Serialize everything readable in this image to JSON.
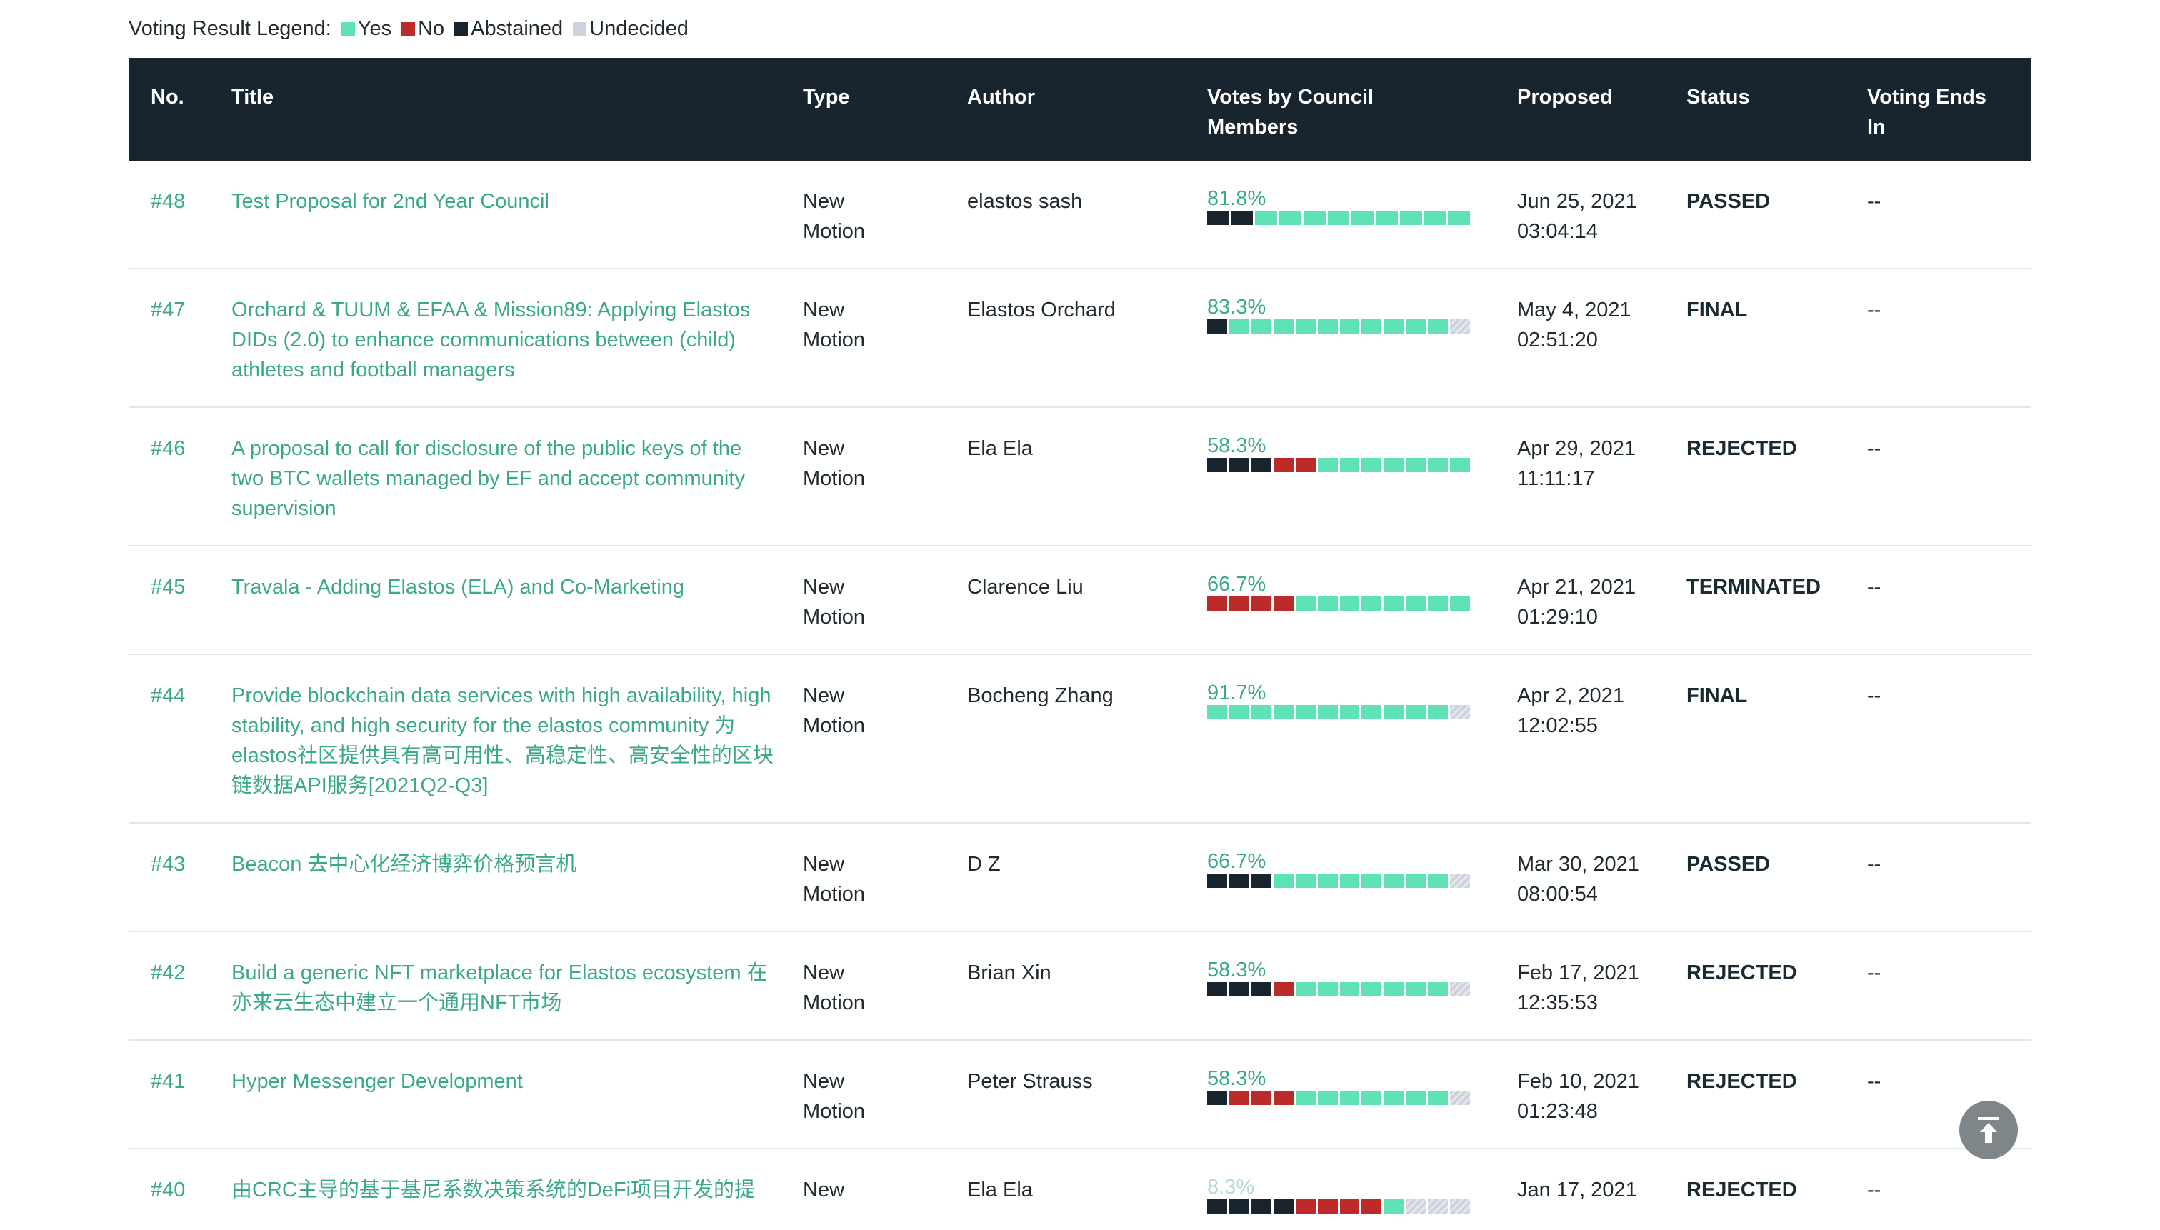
{
  "legend": {
    "label": "Voting Result Legend:",
    "items": [
      {
        "label": "Yes",
        "color": "#5fe3b4"
      },
      {
        "label": "No",
        "color": "#bd2a2a"
      },
      {
        "label": "Abstained",
        "color": "#18252f"
      },
      {
        "label": "Undecided",
        "color": "#cdd3dc"
      }
    ]
  },
  "colors": {
    "yes": "#5fe3b4",
    "no": "#bd2a2a",
    "abstained": "#18252f",
    "undecided": "#cdd3dc",
    "header_bg": "#18252f",
    "link": "#3aa98b"
  },
  "table": {
    "headers": {
      "no": "No.",
      "title": "Title",
      "type": "Type",
      "author": "Author",
      "votes": "Votes by Council Members",
      "proposed": "Proposed",
      "status": "Status",
      "ends": "Voting Ends In"
    },
    "rows": [
      {
        "no": "#48",
        "title": "Test Proposal for 2nd Year Council",
        "type": "New Motion",
        "author": "elastos sash",
        "pct": "81.8%",
        "votes": [
          "A",
          "A",
          "Y",
          "Y",
          "Y",
          "Y",
          "Y",
          "Y",
          "Y",
          "Y",
          "Y"
        ],
        "proposed": "Jun 25, 2021 03:04:14",
        "status": "PASSED",
        "ends": "--"
      },
      {
        "no": "#47",
        "title": "Orchard & TUUM & EFAA & Mission89: Applying Elastos DIDs (2.0) to enhance communications between (child) athletes and football managers",
        "type": "New Motion",
        "author": "Elastos Orchard",
        "pct": "83.3%",
        "votes": [
          "A",
          "Y",
          "Y",
          "Y",
          "Y",
          "Y",
          "Y",
          "Y",
          "Y",
          "Y",
          "Y",
          "U"
        ],
        "proposed": "May 4, 2021 02:51:20",
        "status": "FINAL",
        "ends": "--"
      },
      {
        "no": "#46",
        "title": "A proposal to call for disclosure of the public keys of the two BTC wallets managed by EF and accept community supervision",
        "type": "New Motion",
        "author": "Ela Ela",
        "pct": "58.3%",
        "votes": [
          "A",
          "A",
          "A",
          "N",
          "N",
          "Y",
          "Y",
          "Y",
          "Y",
          "Y",
          "Y",
          "Y"
        ],
        "proposed": "Apr 29, 2021 11:11:17",
        "status": "REJECTED",
        "ends": "--"
      },
      {
        "no": "#45",
        "title": "Travala - Adding Elastos (ELA) and Co-Marketing",
        "type": "New Motion",
        "author": "Clarence Liu",
        "pct": "66.7%",
        "votes": [
          "N",
          "N",
          "N",
          "N",
          "Y",
          "Y",
          "Y",
          "Y",
          "Y",
          "Y",
          "Y",
          "Y"
        ],
        "proposed": "Apr 21, 2021 01:29:10",
        "status": "TERMINATED",
        "ends": "--"
      },
      {
        "no": "#44",
        "title": "Provide blockchain data services with high availability, high stability, and high security for the elastos community 为elastos社区提供具有高可用性、高稳定性、高安全性的区块链数据API服务[2021Q2-Q3]",
        "type": "New Motion",
        "author": "Bocheng Zhang",
        "pct": "91.7%",
        "votes": [
          "Y",
          "Y",
          "Y",
          "Y",
          "Y",
          "Y",
          "Y",
          "Y",
          "Y",
          "Y",
          "Y",
          "U"
        ],
        "proposed": "Apr 2, 2021 12:02:55",
        "status": "FINAL",
        "ends": "--"
      },
      {
        "no": "#43",
        "title": "Beacon 去中心化经济博弈价格预言机",
        "type": "New Motion",
        "author": "D Z",
        "pct": "66.7%",
        "votes": [
          "A",
          "A",
          "A",
          "Y",
          "Y",
          "Y",
          "Y",
          "Y",
          "Y",
          "Y",
          "Y",
          "U"
        ],
        "proposed": "Mar 30, 2021 08:00:54",
        "status": "PASSED",
        "ends": "--"
      },
      {
        "no": "#42",
        "title": "Build a generic NFT marketplace for Elastos ecosystem 在亦来云生态中建立一个通用NFT市场",
        "type": "New Motion",
        "author": "Brian Xin",
        "pct": "58.3%",
        "votes": [
          "A",
          "A",
          "A",
          "N",
          "Y",
          "Y",
          "Y",
          "Y",
          "Y",
          "Y",
          "Y",
          "U"
        ],
        "proposed": "Feb 17, 2021 12:35:53",
        "status": "REJECTED",
        "ends": "--"
      },
      {
        "no": "#41",
        "title": "Hyper Messenger Development",
        "type": "New Motion",
        "author": "Peter Strauss",
        "pct": "58.3%",
        "votes": [
          "A",
          "N",
          "N",
          "N",
          "Y",
          "Y",
          "Y",
          "Y",
          "Y",
          "Y",
          "Y",
          "U"
        ],
        "proposed": "Feb 10, 2021 01:23:48",
        "status": "REJECTED",
        "ends": "--"
      },
      {
        "no": "#40",
        "title": "由CRC主导的基于基尼系数决策系统的DeFi项目开发的提",
        "type": "New",
        "author": "Ela Ela",
        "pct": "8.3%",
        "pct_faded": true,
        "votes": [
          "A",
          "A",
          "A",
          "A",
          "N",
          "N",
          "N",
          "N",
          "Y",
          "U",
          "U",
          "U"
        ],
        "proposed": "Jan 17, 2021",
        "status": "REJECTED",
        "ends": "--"
      }
    ]
  },
  "scroll_top_icon": "arrow-up-to-line-icon"
}
